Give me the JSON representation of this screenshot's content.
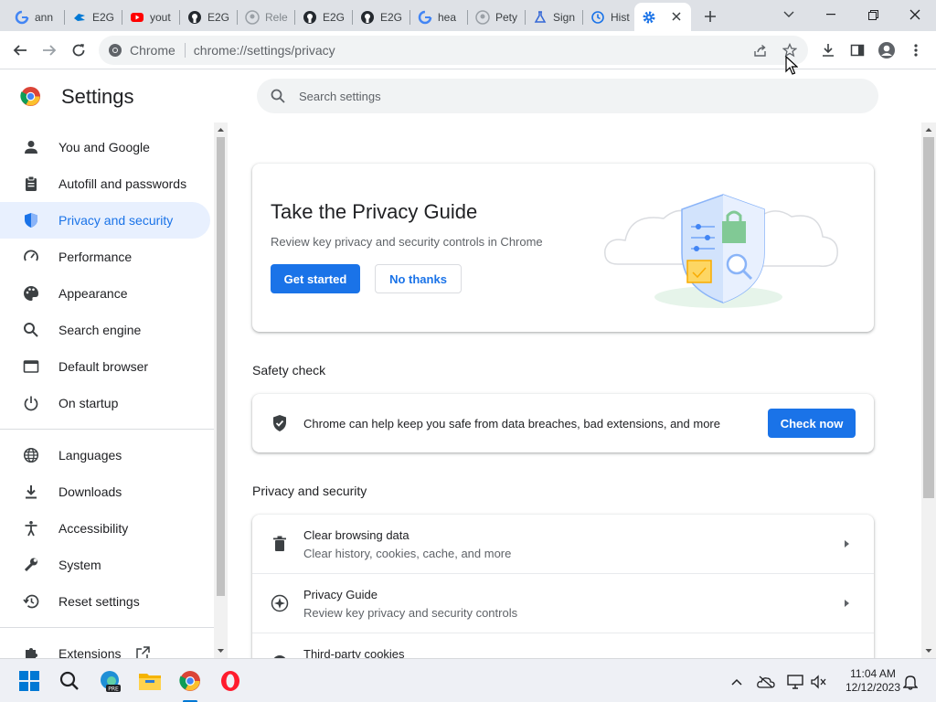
{
  "tabs": [
    {
      "label": "ann",
      "icon": "google-icon"
    },
    {
      "label": "E2G",
      "icon": "azure-devops-icon"
    },
    {
      "label": "yout",
      "icon": "youtube-icon"
    },
    {
      "label": "E2G",
      "icon": "github-icon"
    },
    {
      "label": "Rele",
      "icon": "github-icon"
    },
    {
      "label": "E2G",
      "icon": "github-icon"
    },
    {
      "label": "E2G",
      "icon": "github-icon"
    },
    {
      "label": "hea",
      "icon": "google-icon"
    },
    {
      "label": "Pety",
      "icon": "github-icon"
    },
    {
      "label": "Sign",
      "icon": "flask-icon"
    },
    {
      "label": "Hist",
      "icon": "history-icon"
    },
    {
      "label": "",
      "icon": "settings-gear-icon"
    }
  ],
  "omnibox": {
    "site_name": "Chrome",
    "url": "chrome://settings/privacy"
  },
  "settings": {
    "title": "Settings",
    "search_placeholder": "Search settings"
  },
  "sidebar": {
    "items": [
      {
        "label": "You and Google",
        "icon": "person-icon"
      },
      {
        "label": "Autofill and passwords",
        "icon": "clipboard-icon"
      },
      {
        "label": "Privacy and security",
        "icon": "shield-icon",
        "active": true
      },
      {
        "label": "Performance",
        "icon": "speedometer-icon"
      },
      {
        "label": "Appearance",
        "icon": "palette-icon"
      },
      {
        "label": "Search engine",
        "icon": "search-icon"
      },
      {
        "label": "Default browser",
        "icon": "browser-window-icon"
      },
      {
        "label": "On startup",
        "icon": "power-icon"
      },
      {
        "label": "Languages",
        "icon": "globe-icon"
      },
      {
        "label": "Downloads",
        "icon": "download-icon"
      },
      {
        "label": "Accessibility",
        "icon": "accessibility-icon"
      },
      {
        "label": "System",
        "icon": "wrench-icon"
      },
      {
        "label": "Reset settings",
        "icon": "reset-history-icon"
      },
      {
        "label": "Extensions",
        "icon": "puzzle-icon"
      }
    ]
  },
  "privacy_guide_card": {
    "title": "Take the Privacy Guide",
    "description": "Review key privacy and security controls in Chrome",
    "primary_button": "Get started",
    "secondary_button": "No thanks"
  },
  "safety_check": {
    "section_title": "Safety check",
    "text": "Chrome can help keep you safe from data breaches, bad extensions, and more",
    "button": "Check now"
  },
  "privacy_section": {
    "section_title": "Privacy and security",
    "rows": [
      {
        "title": "Clear browsing data",
        "subtitle": "Clear history, cookies, cache, and more",
        "icon": "trash-icon"
      },
      {
        "title": "Privacy Guide",
        "subtitle": "Review key privacy and security controls",
        "icon": "compass-icon"
      },
      {
        "title": "Third-party cookies",
        "subtitle": "",
        "icon": "cookie-icon"
      }
    ]
  },
  "taskbar": {
    "time": "11:04 AM",
    "date": "12/12/2023"
  },
  "colors": {
    "accent": "#1a73e8",
    "active_nav_bg": "#e8f0fe",
    "tabstrip_bg": "#dee1e6"
  }
}
